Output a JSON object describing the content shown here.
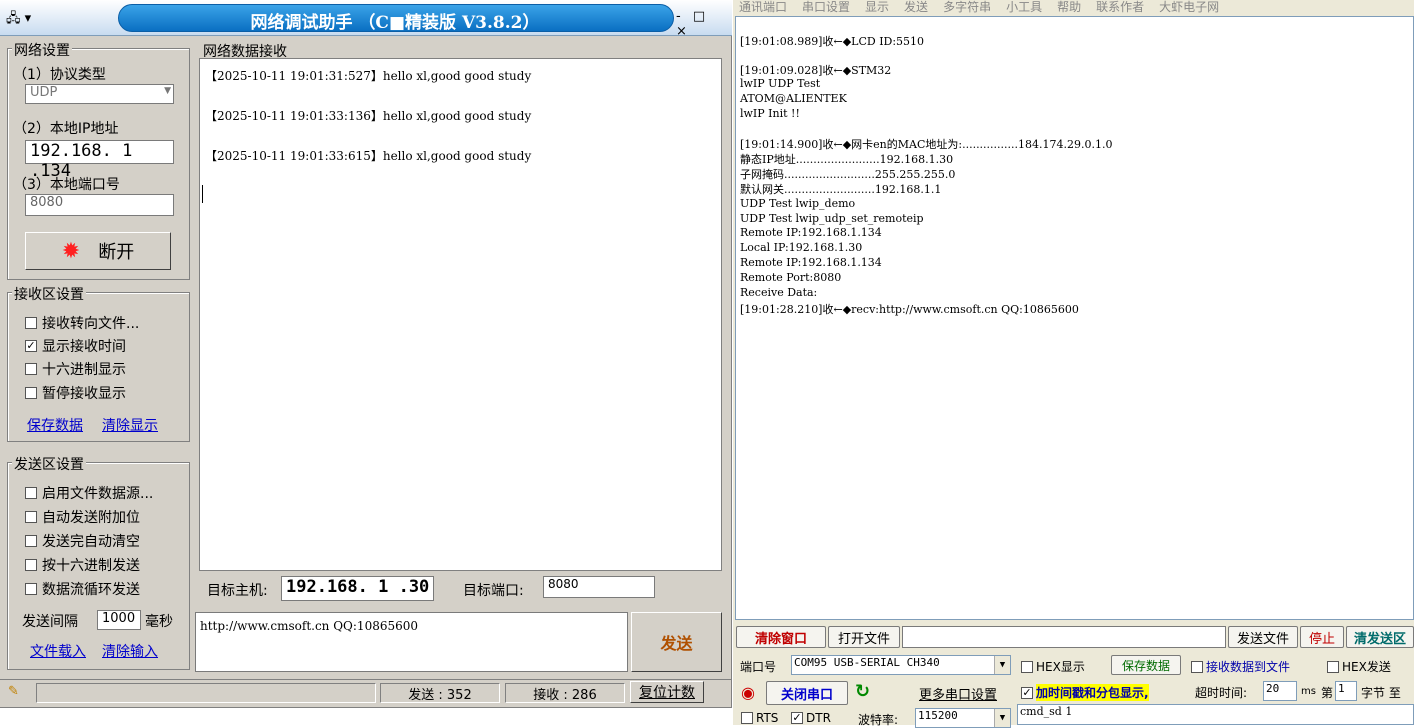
{
  "netassist": {
    "title": "网络调试助手 （C■精装版 V3.8.2）",
    "window_buttons": "- □ ×",
    "net_settings": {
      "group_title": "网络设置",
      "protocol_label": "（1）协议类型",
      "protocol_value": "UDP",
      "local_ip_label": "（2）本地IP地址",
      "local_ip_value": "192.168. 1 .134",
      "local_port_label": "（3）本地端口号",
      "local_port_value": "8080",
      "disconnect_label": "断开"
    },
    "recv_settings": {
      "group_title": "接收区设置",
      "options": [
        {
          "label": "接收转向文件...",
          "checked": false
        },
        {
          "label": "显示接收时间",
          "checked": true
        },
        {
          "label": "十六进制显示",
          "checked": false
        },
        {
          "label": "暂停接收显示",
          "checked": false
        }
      ],
      "save_link": "保存数据",
      "clear_link": "清除显示"
    },
    "send_settings": {
      "group_title": "发送区设置",
      "options": [
        {
          "label": "启用文件数据源...",
          "checked": false
        },
        {
          "label": "自动发送附加位",
          "checked": false
        },
        {
          "label": "发送完自动清空",
          "checked": false
        },
        {
          "label": "按十六进制发送",
          "checked": false
        },
        {
          "label": "数据流循环发送",
          "checked": false
        }
      ],
      "interval_label": "发送间隔",
      "interval_value": "1000",
      "interval_unit": "毫秒",
      "load_link": "文件载入",
      "clear_input_link": "清除输入"
    },
    "recv_panel_title": "网络数据接收",
    "recv_lines": [
      "【2025-10-11 19:01:31:527】hello xl,good good study",
      "【2025-10-11 19:01:33:136】hello xl,good good study",
      "【2025-10-11 19:01:33:615】hello xl,good good study"
    ],
    "target_host_label": "目标主机:",
    "target_host_value": "192.168. 1 .30",
    "target_port_label": "目标端口:",
    "target_port_value": "8080",
    "send_text": "http://www.cmsoft.cn QQ:10865600",
    "send_button": "发送",
    "status": {
      "sent": "发送 : 352",
      "received": "接收 : 286",
      "reset": "复位计数"
    }
  },
  "serial": {
    "menu": [
      "通讯端口",
      "串口设置",
      "显示",
      "发送",
      "多字符串",
      "小工具",
      "帮助",
      "联系作者",
      "大虾电子网"
    ],
    "recv_lines": [
      "[19:01:08.989]收←◆LCD ID:5510",
      "",
      "[19:01:09.028]收←◆STM32",
      "lwIP UDP Test",
      "ATOM@ALIENTEK",
      "lwIP Init !!",
      "",
      "[19:01:14.900]收←◆网卡en的MAC地址为:................184.174.29.0.1.0",
      "静态IP地址........................192.168.1.30",
      "子网掩码..........................255.255.255.0",
      "默认网关..........................192.168.1.1",
      "UDP Test lwip_demo",
      "UDP Test lwip_udp_set_remoteip",
      "Remote IP:192.168.1.134",
      "Local IP:192.168.1.30",
      "Remote IP:192.168.1.134",
      "Remote Port:8080",
      "Receive Data:",
      "[19:01:28.210]收←◆recv:http://www.cmsoft.cn QQ:10865600"
    ],
    "clear_window": "清除窗口",
    "open_file": "打开文件",
    "send_file": "发送文件",
    "stop": "停止",
    "clear_send": "清发送区",
    "port_label": "端口号",
    "port_value": "COM95 USB-SERIAL CH340",
    "hex_display": "HEX显示",
    "save_data": "保存数据",
    "recv_to_file": "接收数据到文件",
    "hex_send": "HEX发送",
    "close_port": "关闭串口",
    "more_settings": "更多串口设置",
    "timestamp_option": "加时间戳和分包显示,",
    "timeout_label": "超时时间:",
    "timeout_value": "20",
    "timeout_unit": "ms",
    "byte_prefix": "第",
    "byte_value": "1",
    "byte_suffix": "字节 至",
    "rts_label": "RTS",
    "dtr_label": "DTR",
    "baud_label": "波特率:",
    "baud_value": "115200",
    "send_input": "cmd_sd 1"
  }
}
